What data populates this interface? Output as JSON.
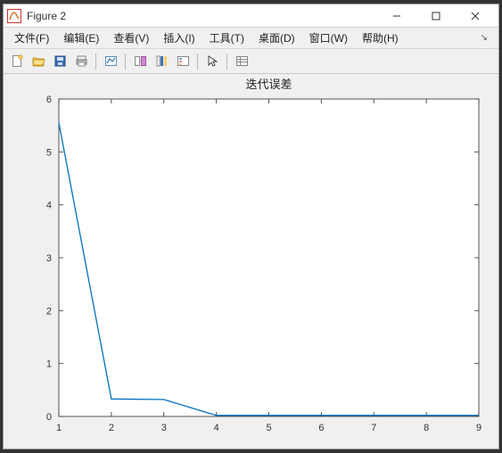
{
  "window": {
    "title": "Figure 2"
  },
  "menu": {
    "file": "文件(F)",
    "edit": "编辑(E)",
    "view": "查看(V)",
    "insert": "插入(I)",
    "tools": "工具(T)",
    "desktop": "桌面(D)",
    "window": "窗口(W)",
    "help": "帮助(H)"
  },
  "toolbar_icons": {
    "new": "new-file-icon",
    "open": "open-folder-icon",
    "save": "save-icon",
    "print": "print-icon",
    "link": "link-icon",
    "datacursor": "data-cursor-icon",
    "colorbar": "colorbar-icon",
    "legend": "legend-icon",
    "pointer": "pointer-icon",
    "propinspect": "property-inspector-icon"
  },
  "chart_data": {
    "type": "line",
    "title": "迭代误差",
    "xlabel": "",
    "ylabel": "",
    "x": [
      1,
      2,
      3,
      4,
      5,
      6,
      7,
      8,
      9
    ],
    "y": [
      5.55,
      0.33,
      0.32,
      0.02,
      0.02,
      0.02,
      0.02,
      0.02,
      0.02
    ],
    "xlim": [
      1,
      9
    ],
    "ylim": [
      0,
      6
    ],
    "xticks": [
      1,
      2,
      3,
      4,
      5,
      6,
      7,
      8,
      9
    ],
    "yticks": [
      0,
      1,
      2,
      3,
      4,
      5,
      6
    ],
    "line_color": "#0072bd"
  }
}
